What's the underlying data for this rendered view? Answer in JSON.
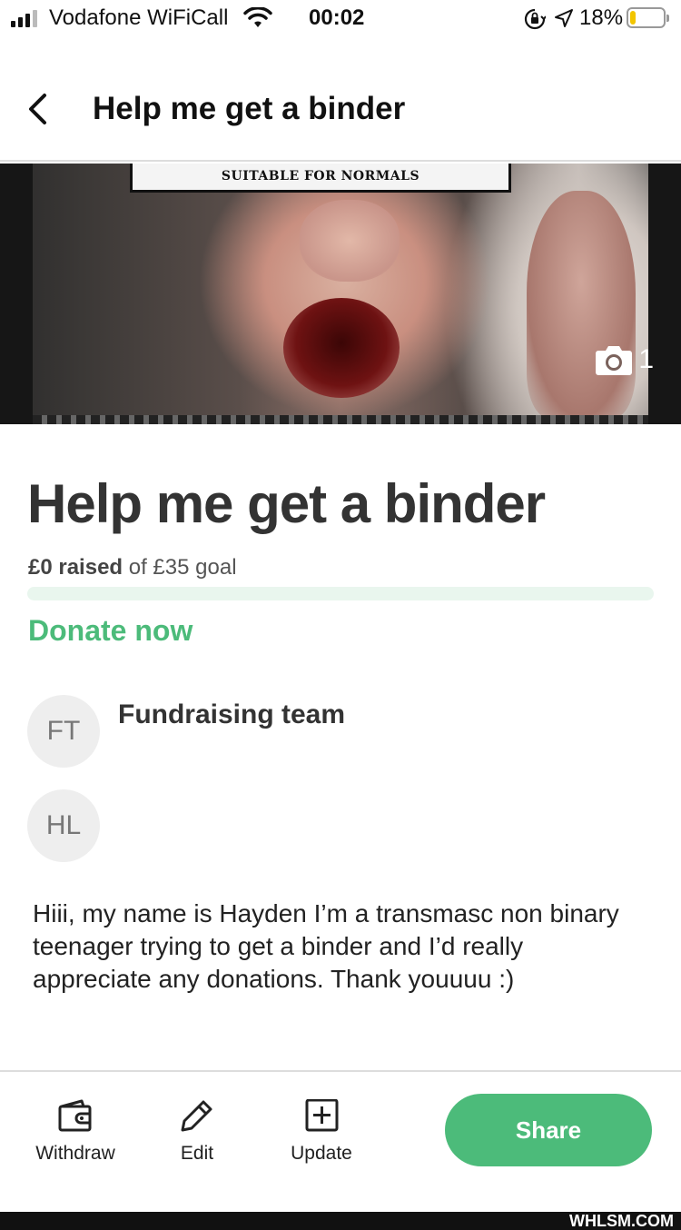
{
  "status_bar": {
    "carrier": "Vodafone WiFiCall",
    "time": "00:02",
    "battery_percent": "18%",
    "battery_level": 0.18,
    "icons": [
      "signal-icon",
      "wifi-icon",
      "rotation-lock-icon",
      "location-icon",
      "battery-icon"
    ]
  },
  "header": {
    "title": "Help me get a binder",
    "back_icon": "chevron-left-icon"
  },
  "hero": {
    "banner_text": "SUITABLE FOR NORMALS",
    "photo_count": "1",
    "photo_icon": "camera-icon"
  },
  "campaign": {
    "title": "Help me get a binder",
    "raised_amount": "£0 raised",
    "goal_text": "of £35 goal",
    "progress": 0,
    "donate_label": "Donate now",
    "accent_color": "#4cbb7a"
  },
  "team": {
    "label": "Fundraising team",
    "members": [
      {
        "initials": "FT"
      },
      {
        "initials": "HL"
      }
    ]
  },
  "story": {
    "text": "Hiii, my name is Hayden I’m a transmasc non binary teenager trying to get a binder and I’d really appreciate any donations. Thank youuuu :)"
  },
  "toolbar": {
    "withdraw_label": "Withdraw",
    "edit_label": "Edit",
    "update_label": "Update",
    "share_label": "Share"
  },
  "watermark": "WHLSM.COM"
}
